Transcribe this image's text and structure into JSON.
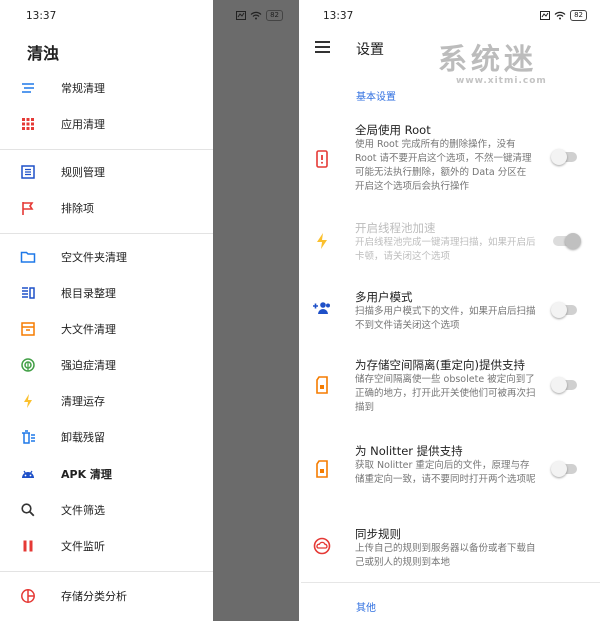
{
  "status": {
    "time": "13:37",
    "battery": "82"
  },
  "drawer": {
    "title": "清浊",
    "items": [
      {
        "label": "常规清理",
        "icon": "sweep-icon"
      },
      {
        "label": "应用清理",
        "icon": "apps-grid-icon"
      },
      {
        "label": "规则管理",
        "icon": "list-icon"
      },
      {
        "label": "排除项",
        "icon": "flag-icon"
      },
      {
        "label": "空文件夹清理",
        "icon": "folder-icon"
      },
      {
        "label": "根目录整理",
        "icon": "root-dir-icon"
      },
      {
        "label": "大文件清理",
        "icon": "archive-box-icon"
      },
      {
        "label": "强迫症清理",
        "icon": "fingerprint-icon"
      },
      {
        "label": "清理运存",
        "icon": "lightning-icon"
      },
      {
        "label": "卸载残留",
        "icon": "uninstall-trash-icon"
      },
      {
        "label": "APK 清理",
        "icon": "android-icon"
      },
      {
        "label": "文件筛选",
        "icon": "search-icon"
      },
      {
        "label": "文件监听",
        "icon": "pause-icon"
      },
      {
        "label": "存储分类分析",
        "icon": "pie-chart-icon"
      }
    ]
  },
  "settings": {
    "title": "设置",
    "watermark": {
      "main": "系统迷",
      "sub": "www.xitmi.com"
    },
    "section_basic": "基本设置",
    "section_other": "其他",
    "prefs": [
      {
        "title": "全局使用 Root",
        "summary": "使用 Root 完成所有的删除操作，没有 Root 请不要开启这个选项，不然一键清理可能无法执行删除，额外的 Data 分区在 开启这个选项后会执行操作",
        "icon": "phone-alert-icon",
        "switch": "off"
      },
      {
        "title": "开启线程池加速",
        "summary": "开启线程池完成一键清理扫描，如果开启后卡顿，请关闭这个选项",
        "icon": "lightning-icon",
        "switch": "on",
        "disabled": true
      },
      {
        "title": "多用户模式",
        "summary": "扫描多用户模式下的文件，如果开启后扫描不到文件请关闭这个选项",
        "icon": "add-users-icon",
        "switch": "off"
      },
      {
        "title": "为存储空间隔离(重定向)提供支持",
        "summary": "储存空间隔离使一些 obsolete 被定向到了正确的地方，打开此开关使他们可被再次扫描到",
        "icon": "sd-card-icon",
        "switch": "off"
      },
      {
        "title": "为 Nolitter 提供支持",
        "summary": "获取 Nolitter 重定向后的文件，原理与存储重定向一致，请不要同时打开两个选项呢",
        "icon": "sd-card-icon",
        "switch": "off"
      },
      {
        "title": "同步规则",
        "summary": "上传自己的规则到服务器以备份或者下载自己或别人的规则到本地",
        "icon": "sync-cloud-icon"
      }
    ]
  },
  "colors": {
    "accent": "#2f6fe0",
    "scrim": "#6b6b6b",
    "icon_red": "#e53935",
    "icon_orange": "#f57c00",
    "icon_blue": "#1e50c8"
  }
}
